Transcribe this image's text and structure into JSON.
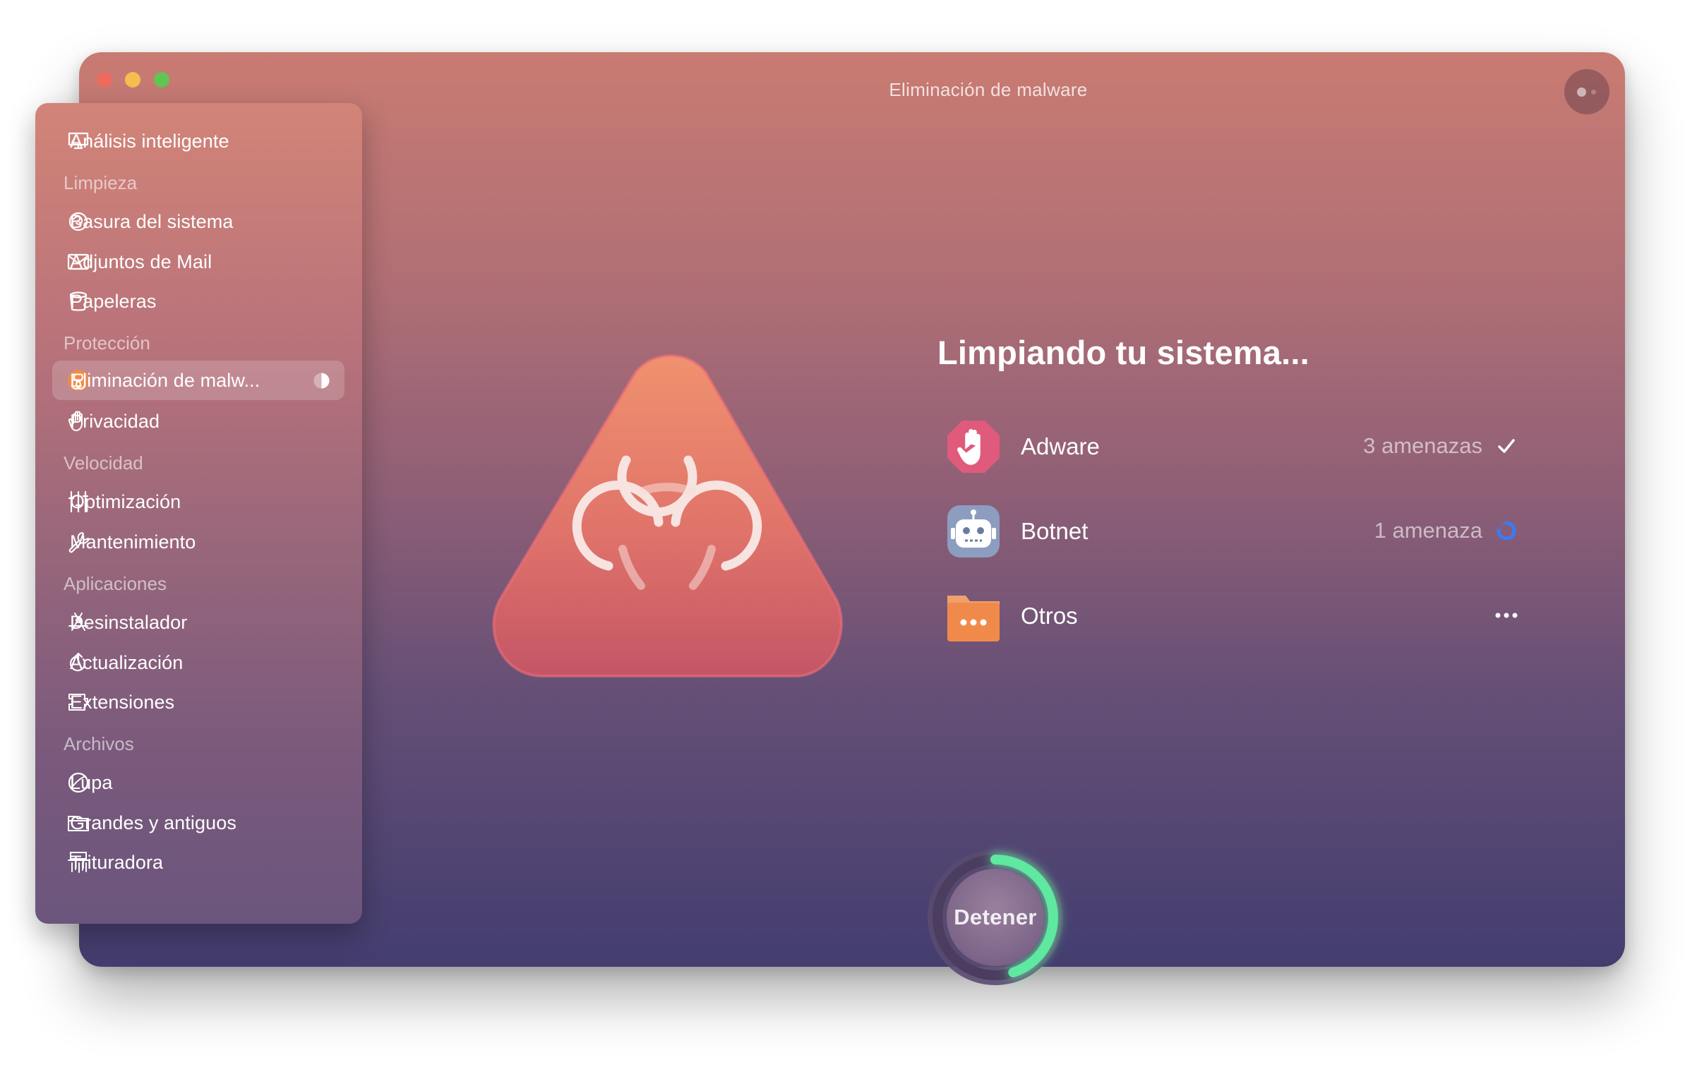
{
  "window": {
    "title": "Eliminación de malware"
  },
  "sidebar": {
    "top_item": {
      "label": "Análisis inteligente",
      "icon": "monitor-icon"
    },
    "sections": [
      {
        "title": "Limpieza",
        "items": [
          {
            "label": "Basura del sistema",
            "icon": "system-junk-icon"
          },
          {
            "label": "Adjuntos de Mail",
            "icon": "mail-icon"
          },
          {
            "label": "Papeleras",
            "icon": "trash-icon"
          }
        ]
      },
      {
        "title": "Protección",
        "items": [
          {
            "label": "Eliminación de malw...",
            "icon": "biohazard-icon",
            "active": true,
            "progress": 0.5
          },
          {
            "label": "Privacidad",
            "icon": "hand-icon"
          }
        ]
      },
      {
        "title": "Velocidad",
        "items": [
          {
            "label": "Optimización",
            "icon": "sliders-icon"
          },
          {
            "label": "Mantenimiento",
            "icon": "wrench-icon"
          }
        ]
      },
      {
        "title": "Aplicaciones",
        "items": [
          {
            "label": "Desinstalador",
            "icon": "app-store-icon"
          },
          {
            "label": "Actualización",
            "icon": "update-arrow-icon"
          },
          {
            "label": "Extensiones",
            "icon": "extension-icon"
          }
        ]
      },
      {
        "title": "Archivos",
        "items": [
          {
            "label": "Lupa",
            "icon": "lens-icon"
          },
          {
            "label": "Grandes y antiguos",
            "icon": "folder-icon"
          },
          {
            "label": "Trituradora",
            "icon": "shredder-icon"
          }
        ]
      }
    ]
  },
  "main": {
    "heading": "Limpiando tu sistema...",
    "threats": [
      {
        "name": "Adware",
        "count": "3 amenazas",
        "status": "done",
        "icon": "adware-hand-icon"
      },
      {
        "name": "Botnet",
        "count": "1 amenaza",
        "status": "scanning",
        "icon": "botnet-robot-icon"
      },
      {
        "name": "Otros",
        "count": "",
        "status": "pending",
        "icon": "others-folder-icon"
      }
    ],
    "stop_button": {
      "label": "Detener",
      "progress": 0.45
    }
  },
  "colors": {
    "accent_green": "#5ee8a0",
    "scan_blue": "#3a7bf5",
    "adware_pink": "#e05a7c",
    "botnet_gray": "#8d9dc0",
    "others_orange": "#f08a4b"
  }
}
